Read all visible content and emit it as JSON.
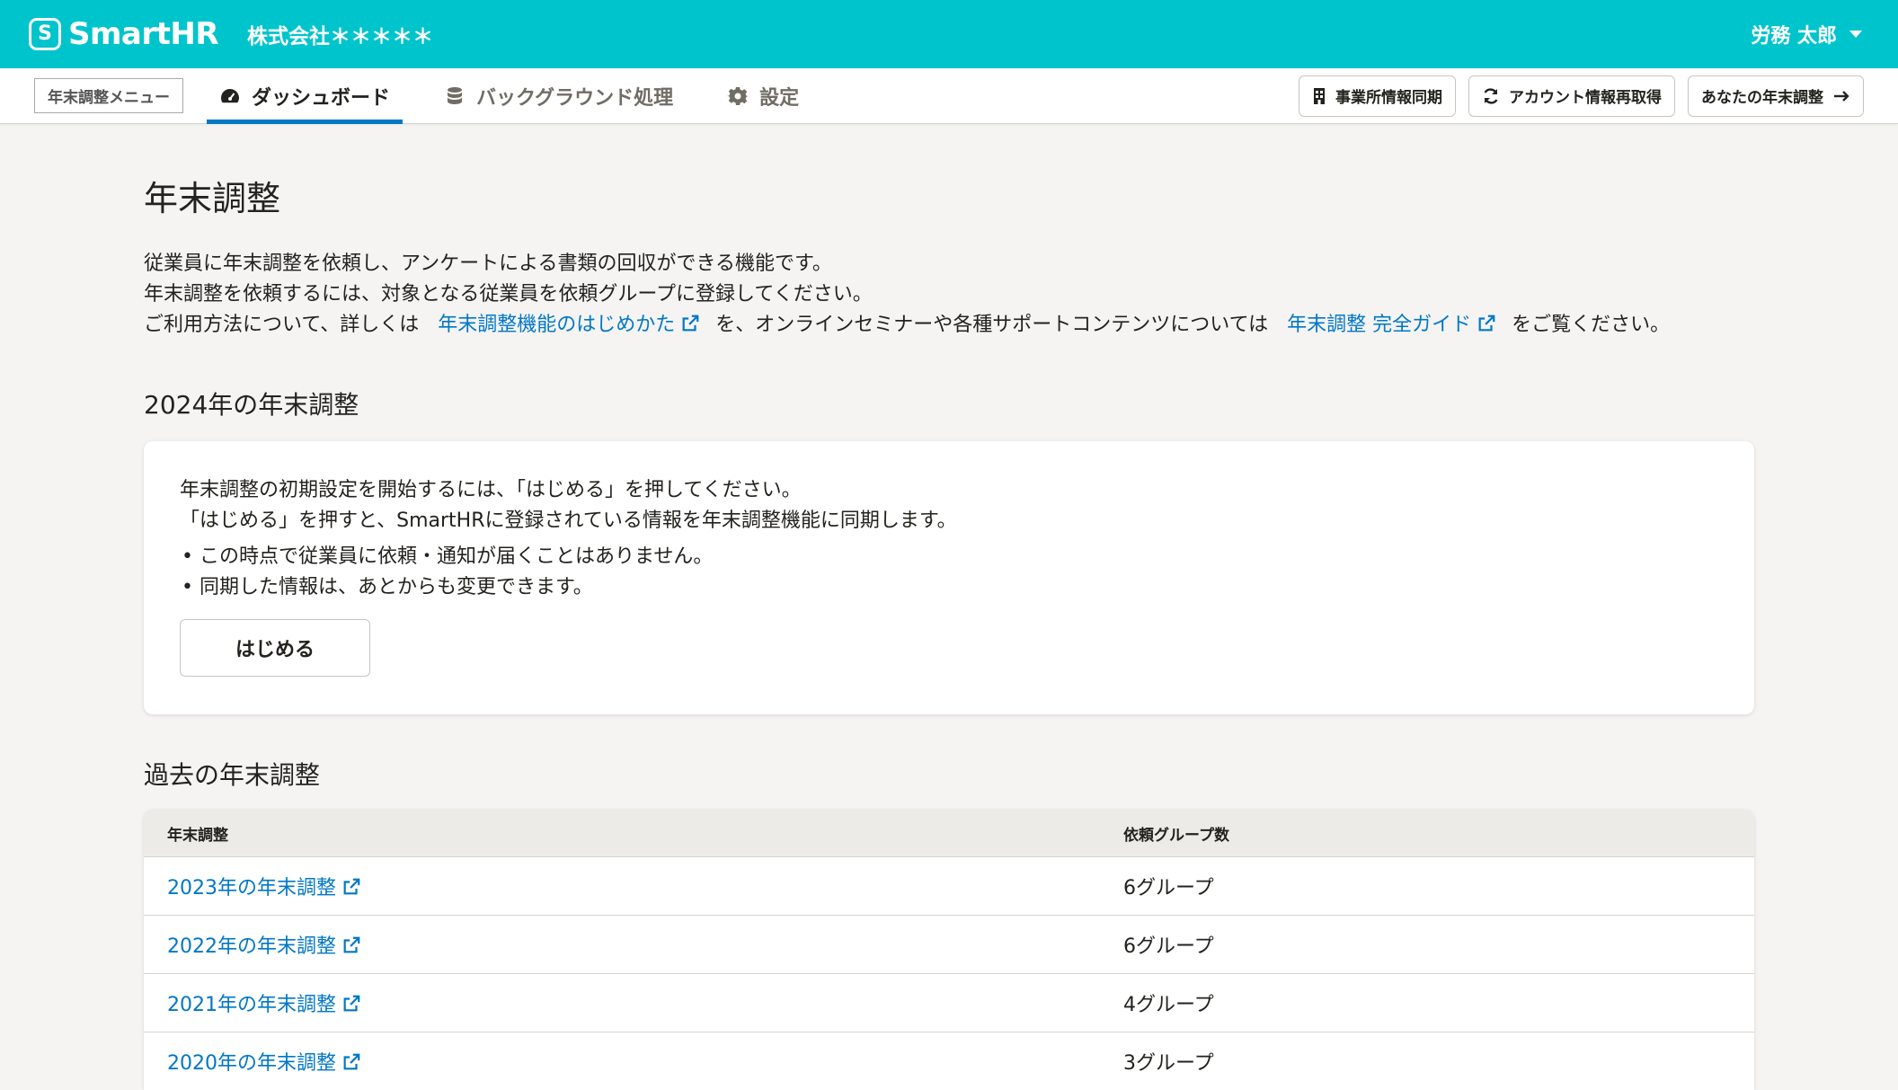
{
  "header": {
    "logo_text": "SmartHR",
    "logo_mark": "S",
    "company": "株式会社＊＊＊＊＊",
    "user_name": "労務 太郎"
  },
  "subnav": {
    "menu_label": "年末調整メニュー",
    "tabs": [
      {
        "label": "ダッシュボード",
        "icon": "dashboard-icon",
        "active": true
      },
      {
        "label": "バックグラウンド処理",
        "icon": "database-icon",
        "active": false
      },
      {
        "label": "設定",
        "icon": "gear-icon",
        "active": false
      }
    ],
    "actions": [
      {
        "label": "事業所情報同期",
        "icon": "building-icon"
      },
      {
        "label": "アカウント情報再取得",
        "icon": "refresh-icon"
      },
      {
        "label": "あなたの年末調整",
        "icon": "arrow-right-icon"
      }
    ]
  },
  "main": {
    "title": "年末調整",
    "desc_line1": "従業員に年末調整を依頼し、アンケートによる書類の回収ができる機能です。",
    "desc_line2": "年末調整を依頼するには、対象となる従業員を依頼グループに登録してください。",
    "desc_line3_pre": "ご利用方法について、詳しくは",
    "desc_link1": "年末調整機能のはじめかた",
    "desc_line3_mid": "を、オンラインセミナーや各種サポートコンテンツについては",
    "desc_link2": "年末調整 完全ガイド",
    "desc_line3_post": "をご覧ください。",
    "current_section": {
      "title": "2024年の年末調整",
      "line1": "年末調整の初期設定を開始するには、「はじめる」を押してください。",
      "line2": "「はじめる」を押すと、SmartHRに登録されている情報を年末調整機能に同期します。",
      "bullets": [
        "この時点で従業員に依頼・通知が届くことはありません。",
        "同期した情報は、あとからも変更できます。"
      ],
      "start_button": "はじめる"
    },
    "past_section": {
      "title": "過去の年末調整",
      "columns": [
        "年末調整",
        "依頼グループ数"
      ],
      "rows": [
        {
          "name": "2023年の年末調整",
          "groups": "6グループ"
        },
        {
          "name": "2022年の年末調整",
          "groups": "6グループ"
        },
        {
          "name": "2021年の年末調整",
          "groups": "4グループ"
        },
        {
          "name": "2020年の年末調整",
          "groups": "3グループ"
        }
      ]
    }
  },
  "colors": {
    "brand": "#00c4cc",
    "link": "#0077c7",
    "background": "#f5f4f3"
  }
}
